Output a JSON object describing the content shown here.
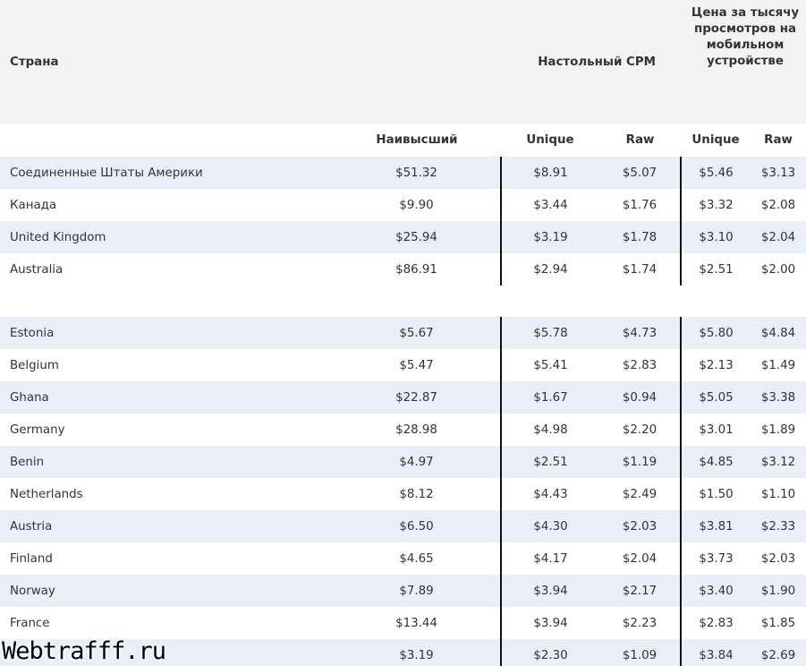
{
  "header": {
    "country": "Страна",
    "desktop_cpm": "Настольный CPM",
    "mobile_cpm": "Цена за тысячу просмотров на мобильном устройстве"
  },
  "subheader": {
    "highest": "Наивысший",
    "desktop_unique": "Unique",
    "desktop_raw": "Raw",
    "mobile_unique": "Unique",
    "mobile_raw": "Raw"
  },
  "group1": [
    {
      "country": "Соединенные Штаты Америки",
      "highest": "$51.32",
      "desktop_unique": "$8.91",
      "desktop_raw": "$5.07",
      "mobile_unique": "$5.46",
      "mobile_raw": "$3.13"
    },
    {
      "country": "Канада",
      "highest": "$9.90",
      "desktop_unique": "$3.44",
      "desktop_raw": "$1.76",
      "mobile_unique": "$3.32",
      "mobile_raw": "$2.08"
    },
    {
      "country": "United Kingdom",
      "highest": "$25.94",
      "desktop_unique": "$3.19",
      "desktop_raw": "$1.78",
      "mobile_unique": "$3.10",
      "mobile_raw": "$2.04"
    },
    {
      "country": "Australia",
      "highest": "$86.91",
      "desktop_unique": "$2.94",
      "desktop_raw": "$1.74",
      "mobile_unique": "$2.51",
      "mobile_raw": "$2.00"
    }
  ],
  "group2": [
    {
      "country": "Estonia",
      "highest": "$5.67",
      "desktop_unique": "$5.78",
      "desktop_raw": "$4.73",
      "mobile_unique": "$5.80",
      "mobile_raw": "$4.84"
    },
    {
      "country": "Belgium",
      "highest": "$5.47",
      "desktop_unique": "$5.41",
      "desktop_raw": "$2.83",
      "mobile_unique": "$2.13",
      "mobile_raw": "$1.49"
    },
    {
      "country": "Ghana",
      "highest": "$22.87",
      "desktop_unique": "$1.67",
      "desktop_raw": "$0.94",
      "mobile_unique": "$5.05",
      "mobile_raw": "$3.38"
    },
    {
      "country": "Germany",
      "highest": "$28.98",
      "desktop_unique": "$4.98",
      "desktop_raw": "$2.20",
      "mobile_unique": "$3.01",
      "mobile_raw": "$1.89"
    },
    {
      "country": "Benin",
      "highest": "$4.97",
      "desktop_unique": "$2.51",
      "desktop_raw": "$1.19",
      "mobile_unique": "$4.85",
      "mobile_raw": "$3.12"
    },
    {
      "country": "Netherlands",
      "highest": "$8.12",
      "desktop_unique": "$4.43",
      "desktop_raw": "$2.49",
      "mobile_unique": "$1.50",
      "mobile_raw": "$1.10"
    },
    {
      "country": "Austria",
      "highest": "$6.50",
      "desktop_unique": "$4.30",
      "desktop_raw": "$2.03",
      "mobile_unique": "$3.81",
      "mobile_raw": "$2.33"
    },
    {
      "country": "Finland",
      "highest": "$4.65",
      "desktop_unique": "$4.17",
      "desktop_raw": "$2.04",
      "mobile_unique": "$3.73",
      "mobile_raw": "$2.03"
    },
    {
      "country": "Norway",
      "highest": "$7.89",
      "desktop_unique": "$3.94",
      "desktop_raw": "$2.17",
      "mobile_unique": "$3.40",
      "mobile_raw": "$1.90"
    },
    {
      "country": "France",
      "highest": "$13.44",
      "desktop_unique": "$3.94",
      "desktop_raw": "$2.23",
      "mobile_unique": "$2.83",
      "mobile_raw": "$1.85"
    },
    {
      "country": "",
      "highest": "$3.19",
      "desktop_unique": "$2.30",
      "desktop_raw": "$1.09",
      "mobile_unique": "$3.84",
      "mobile_raw": "$2.69"
    }
  ],
  "watermark": "Webtrafff.ru",
  "colors": {
    "header_bg": "#f3f3f3",
    "row_shade": "#e9eff8",
    "divider": "#111111"
  }
}
